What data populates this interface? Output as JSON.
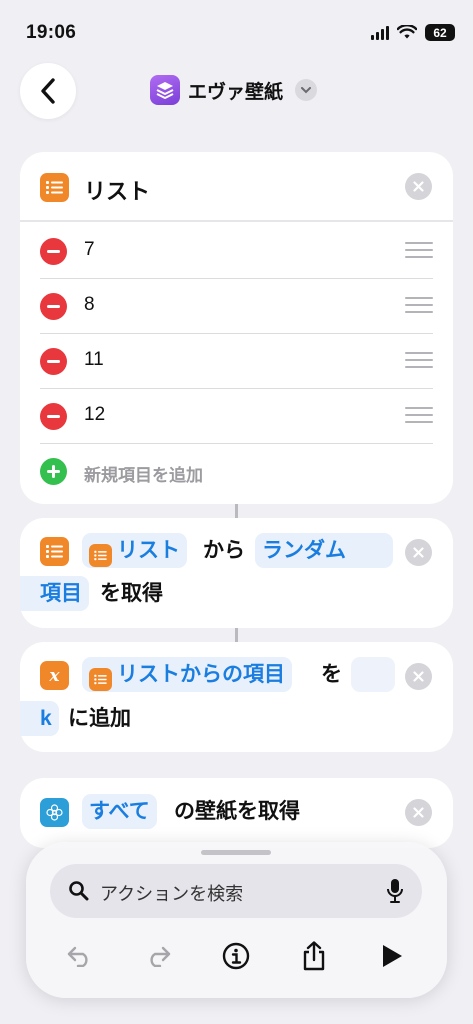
{
  "status_bar": {
    "time": "19:06",
    "battery": "62"
  },
  "nav": {
    "title": "エヴァ壁紙"
  },
  "list_card": {
    "title": "リスト",
    "items": [
      {
        "value": "7"
      },
      {
        "value": "8"
      },
      {
        "value": "11"
      },
      {
        "value": "12"
      }
    ],
    "add_label": "新規項目を追加"
  },
  "action_random": {
    "token_list": "リスト",
    "text_from": "から",
    "token_random": "ランダム",
    "token_item": "項目",
    "text_get": "を取得"
  },
  "action_add_var": {
    "token_items": "リストからの項目",
    "text_wo": "を",
    "token_var": "k",
    "text_add": "に追加"
  },
  "action_wallpaper": {
    "token_all": "すべて",
    "text_rest": "の壁紙を取得"
  },
  "bottom_sheet": {
    "search_placeholder": "アクションを検索"
  },
  "colors": {
    "accent": "#1a7de0",
    "list_orange": "#f0882a",
    "delete_red": "#e8383d",
    "add_green": "#34c04e",
    "app_purple": "#9a55e8"
  }
}
